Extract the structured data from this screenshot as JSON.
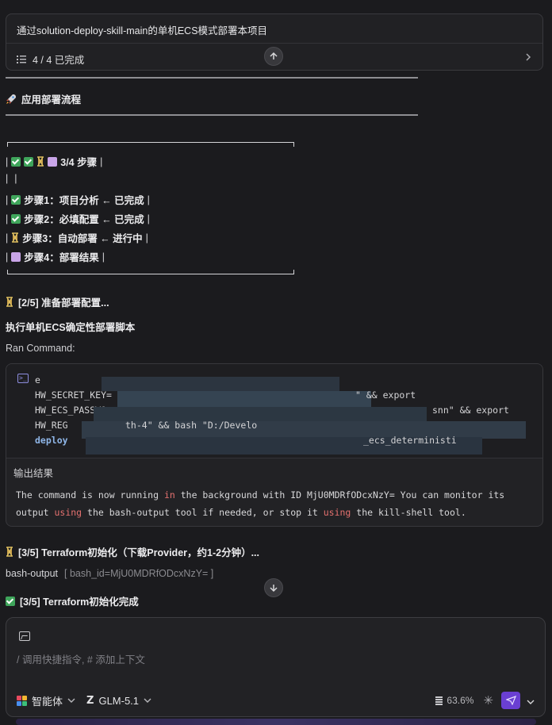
{
  "task": {
    "title": "通过solution-deploy-skill-main的单机ECS模式部署本项目",
    "status": "4 / 4 已完成"
  },
  "section": {
    "title": "应用部署流程"
  },
  "progress_box": {
    "summary": "3/4 步骤",
    "steps": [
      {
        "label": "步骤1：项目分析 ← 已完成",
        "state": "done"
      },
      {
        "label": "步骤2：必填配置 ← 已完成",
        "state": "done"
      },
      {
        "label": "步骤3：自动部署 ← 进行中",
        "state": "running"
      },
      {
        "label": "步骤4：部署结果",
        "state": "pending"
      }
    ]
  },
  "prep_line": "[2/5] 准备部署配置...",
  "exec_heading": "执行单机ECS确定性部署脚本",
  "ran_command_label": "Ran Command:",
  "command": {
    "lines": [
      "e",
      "HW_SECRET_KEY=",
      "HW_ECS_PASSWO",
      "HW_REG",
      "deploy"
    ],
    "line_fragments": [
      "\" && export",
      "snn\" && export",
      "th-4\" && bash \"D:/Develo",
      "_ecs_deterministi"
    ],
    "output_label": "输出结果",
    "output_segments": [
      {
        "text": "The command is now running ",
        "kw": false
      },
      {
        "text": "in",
        "kw": true
      },
      {
        "text": " the background with ID MjU0MDRfODcxNzY= You can monitor its output ",
        "kw": false
      },
      {
        "text": "using",
        "kw": true
      },
      {
        "text": " the bash-output tool if needed, or stop it ",
        "kw": false
      },
      {
        "text": "using",
        "kw": true
      },
      {
        "text": " the kill-shell tool.",
        "kw": false
      }
    ]
  },
  "terraform_line": "[3/5] Terraform初始化（下载Provider，约1-2分钟）...",
  "bash_output": {
    "tool": "bash-output",
    "args": "[ bash_id=MjU0MDRfODcxNzY= ]"
  },
  "terraform_done": "[3/5] Terraform初始化完成",
  "composer": {
    "placeholder": "/ 调用快捷指令, # 添加上下文",
    "agent_label": "智能体",
    "model_label": "GLM-5.1",
    "context_usage": "63.6%"
  },
  "colors": {
    "accent": "#6a3fd2",
    "done": "#3fa55b",
    "pending": "#c9a5e8",
    "keyword": "#e4716f"
  }
}
